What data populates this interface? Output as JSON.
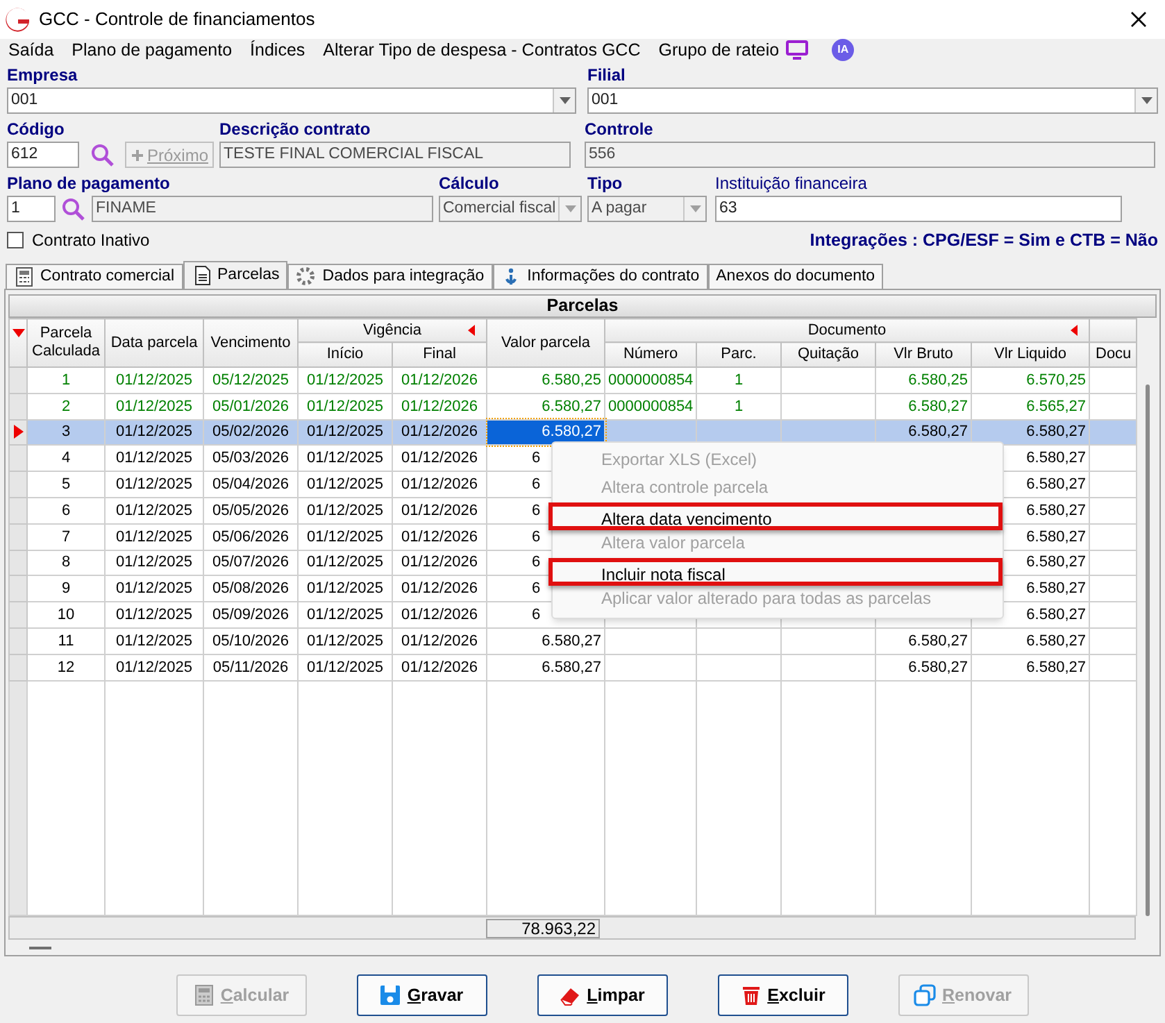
{
  "window": {
    "title": "GCC - Controle de financiamentos"
  },
  "menu": [
    {
      "label": "Saída"
    },
    {
      "label": "Plano de pagamento"
    },
    {
      "label": "Índices"
    },
    {
      "label": "Alterar Tipo de despesa - Contratos GCC"
    },
    {
      "label": "Grupo de rateio"
    }
  ],
  "menu_badge": "IA",
  "form": {
    "empresa": {
      "label": "Empresa",
      "value": "001"
    },
    "filial": {
      "label": "Filial",
      "value": "001"
    },
    "codigo": {
      "label": "Código",
      "value": "612"
    },
    "proximo_button": {
      "label": "Próximo",
      "disabled": true
    },
    "descricao": {
      "label": "Descrição contrato",
      "value": "TESTE FINAL COMERCIAL FISCAL"
    },
    "controle": {
      "label": "Controle",
      "value": "556"
    },
    "plano": {
      "label": "Plano de pagamento",
      "value": "1",
      "description": "FINAME"
    },
    "calculo": {
      "label": "Cálculo",
      "value": "Comercial fiscal",
      "disabled": true
    },
    "tipo": {
      "label": "Tipo",
      "value": "A pagar",
      "disabled": true
    },
    "instituicao": {
      "label": "Instituição financeira",
      "value": "63"
    },
    "contrato_inativo": {
      "label": "Contrato Inativo",
      "checked": false
    },
    "integracoes": "Integrações : CPG/ESF = Sim e CTB = Não"
  },
  "tabs": [
    {
      "label": "Contrato comercial",
      "selected": false
    },
    {
      "label": "Parcelas",
      "selected": true
    },
    {
      "label": "Dados para integração",
      "selected": false
    },
    {
      "label": "Informações do contrato",
      "selected": false
    },
    {
      "label": "Anexos do documento",
      "selected": false
    }
  ],
  "grid": {
    "title": "Parcelas",
    "groups": {
      "vigencia": "Vigência",
      "documento": "Documento"
    },
    "columns": [
      "Parcela Calculada",
      "Data parcela",
      "Vencimento",
      "Início",
      "Final",
      "Valor parcela",
      "Número",
      "Parc.",
      "Quitação",
      "Vlr Bruto",
      "Vlr Liquido",
      "Docu"
    ],
    "rows": [
      {
        "parcela": "1",
        "data_parcela": "01/12/2025",
        "vencimento": "05/12/2025",
        "inicio": "01/12/2025",
        "final": "01/12/2026",
        "valor": "6.580,25",
        "numero": "0000000854",
        "parc": "1",
        "vlr_bruto": "6.580,25",
        "vlr_liquido": "6.570,25",
        "settled": true,
        "selected": false
      },
      {
        "parcela": "2",
        "data_parcela": "01/12/2025",
        "vencimento": "05/01/2026",
        "inicio": "01/12/2025",
        "final": "01/12/2026",
        "valor": "6.580,27",
        "numero": "0000000854",
        "parc": "1",
        "vlr_bruto": "6.580,27",
        "vlr_liquido": "6.565,27",
        "settled": true,
        "selected": false
      },
      {
        "parcela": "3",
        "data_parcela": "01/12/2025",
        "vencimento": "05/02/2026",
        "inicio": "01/12/2025",
        "final": "01/12/2026",
        "valor": "6.580,27",
        "vlr_bruto": "6.580,27",
        "vlr_liquido": "6.580,27",
        "settled": false,
        "selected": true
      },
      {
        "parcela": "4",
        "data_parcela": "01/12/2025",
        "vencimento": "05/03/2026",
        "inicio": "01/12/2025",
        "final": "01/12/2026",
        "valor": "6",
        "vlr_liquido": "6.580,27",
        "settled": false,
        "selected": false
      },
      {
        "parcela": "5",
        "data_parcela": "01/12/2025",
        "vencimento": "05/04/2026",
        "inicio": "01/12/2025",
        "final": "01/12/2026",
        "valor": "6",
        "vlr_liquido": "6.580,27",
        "settled": false,
        "selected": false
      },
      {
        "parcela": "6",
        "data_parcela": "01/12/2025",
        "vencimento": "05/05/2026",
        "inicio": "01/12/2025",
        "final": "01/12/2026",
        "valor": "6",
        "vlr_liquido": "6.580,27",
        "settled": false,
        "selected": false
      },
      {
        "parcela": "7",
        "data_parcela": "01/12/2025",
        "vencimento": "05/06/2026",
        "inicio": "01/12/2025",
        "final": "01/12/2026",
        "valor": "6",
        "vlr_liquido": "6.580,27",
        "settled": false,
        "selected": false
      },
      {
        "parcela": "8",
        "data_parcela": "01/12/2025",
        "vencimento": "05/07/2026",
        "inicio": "01/12/2025",
        "final": "01/12/2026",
        "valor": "6",
        "vlr_liquido": "6.580,27",
        "settled": false,
        "selected": false
      },
      {
        "parcela": "9",
        "data_parcela": "01/12/2025",
        "vencimento": "05/08/2026",
        "inicio": "01/12/2025",
        "final": "01/12/2026",
        "valor": "6",
        "vlr_liquido": "6.580,27",
        "settled": false,
        "selected": false
      },
      {
        "parcela": "10",
        "data_parcela": "01/12/2025",
        "vencimento": "05/09/2026",
        "inicio": "01/12/2025",
        "final": "01/12/2026",
        "valor": "6",
        "vlr_liquido": "6.580,27",
        "settled": false,
        "selected": false
      },
      {
        "parcela": "11",
        "data_parcela": "01/12/2025",
        "vencimento": "05/10/2026",
        "inicio": "01/12/2025",
        "final": "01/12/2026",
        "valor": "6.580,27",
        "vlr_bruto": "6.580,27",
        "vlr_liquido": "6.580,27",
        "settled": false,
        "selected": false
      },
      {
        "parcela": "12",
        "data_parcela": "01/12/2025",
        "vencimento": "05/11/2026",
        "inicio": "01/12/2025",
        "final": "01/12/2026",
        "valor": "6.580,27",
        "vlr_bruto": "6.580,27",
        "vlr_liquido": "6.580,27",
        "settled": false,
        "selected": false
      }
    ],
    "total": "78.963,22"
  },
  "context_menu": [
    {
      "label": "Exportar XLS (Excel)",
      "disabled": true,
      "highlighted": false
    },
    {
      "label": "Altera controle parcela",
      "disabled": true,
      "highlighted": false
    },
    {
      "label": "Altera data vencimento",
      "disabled": false,
      "highlighted": true
    },
    {
      "label": "Altera valor parcela",
      "disabled": true,
      "highlighted": false
    },
    {
      "label": "Incluir nota fiscal",
      "disabled": false,
      "highlighted": true
    },
    {
      "label": "Aplicar valor alterado para todas as parcelas",
      "disabled": true,
      "highlighted": false
    }
  ],
  "buttons": [
    {
      "kind": "calcular",
      "label": "Calcular",
      "disabled": true
    },
    {
      "kind": "gravar",
      "label": "Gravar",
      "disabled": false
    },
    {
      "kind": "limpar",
      "label": "Limpar",
      "disabled": false
    },
    {
      "kind": "excluir",
      "label": "Excluir",
      "disabled": false
    },
    {
      "kind": "renovar",
      "label": "Renovar",
      "disabled": true
    }
  ]
}
